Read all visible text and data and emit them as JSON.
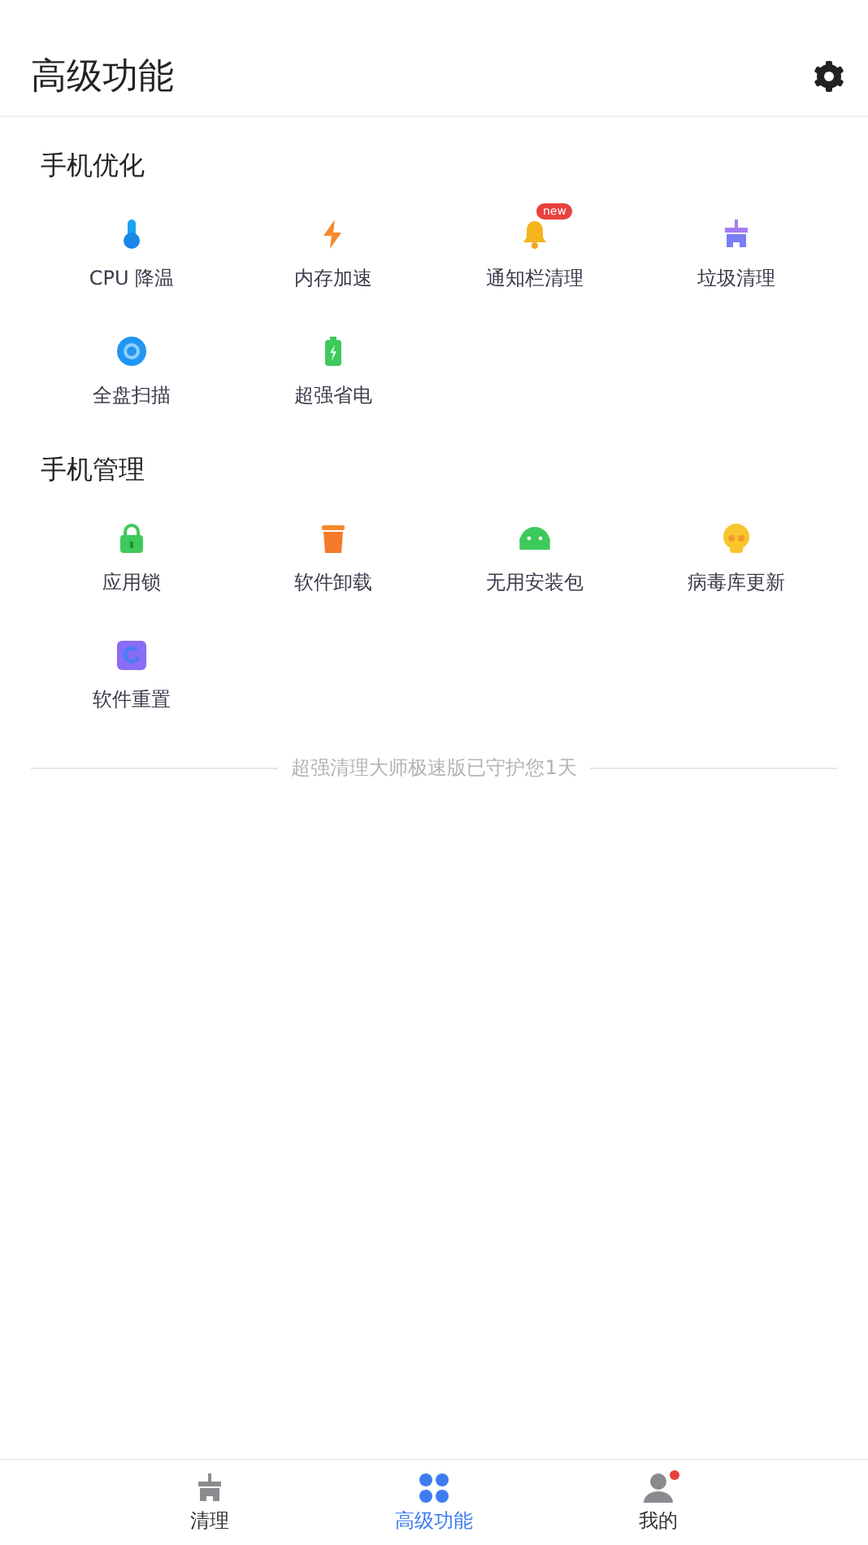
{
  "header": {
    "title": "高级功能"
  },
  "sections": [
    {
      "title": "手机优化",
      "items": [
        {
          "label": "CPU 降温"
        },
        {
          "label": "内存加速"
        },
        {
          "label": "通知栏清理",
          "badge": "new"
        },
        {
          "label": "垃圾清理"
        },
        {
          "label": "全盘扫描"
        },
        {
          "label": "超强省电"
        }
      ]
    },
    {
      "title": "手机管理",
      "items": [
        {
          "label": "应用锁"
        },
        {
          "label": "软件卸载"
        },
        {
          "label": "无用安装包"
        },
        {
          "label": "病毒库更新"
        },
        {
          "label": "软件重置"
        }
      ]
    }
  ],
  "footer_note": "超强清理大师极速版已守护您1天",
  "tabs": [
    {
      "label": "清理",
      "selected": false,
      "dot": false
    },
    {
      "label": "高级功能",
      "selected": true,
      "dot": false
    },
    {
      "label": "我的",
      "selected": false,
      "dot": true
    }
  ]
}
